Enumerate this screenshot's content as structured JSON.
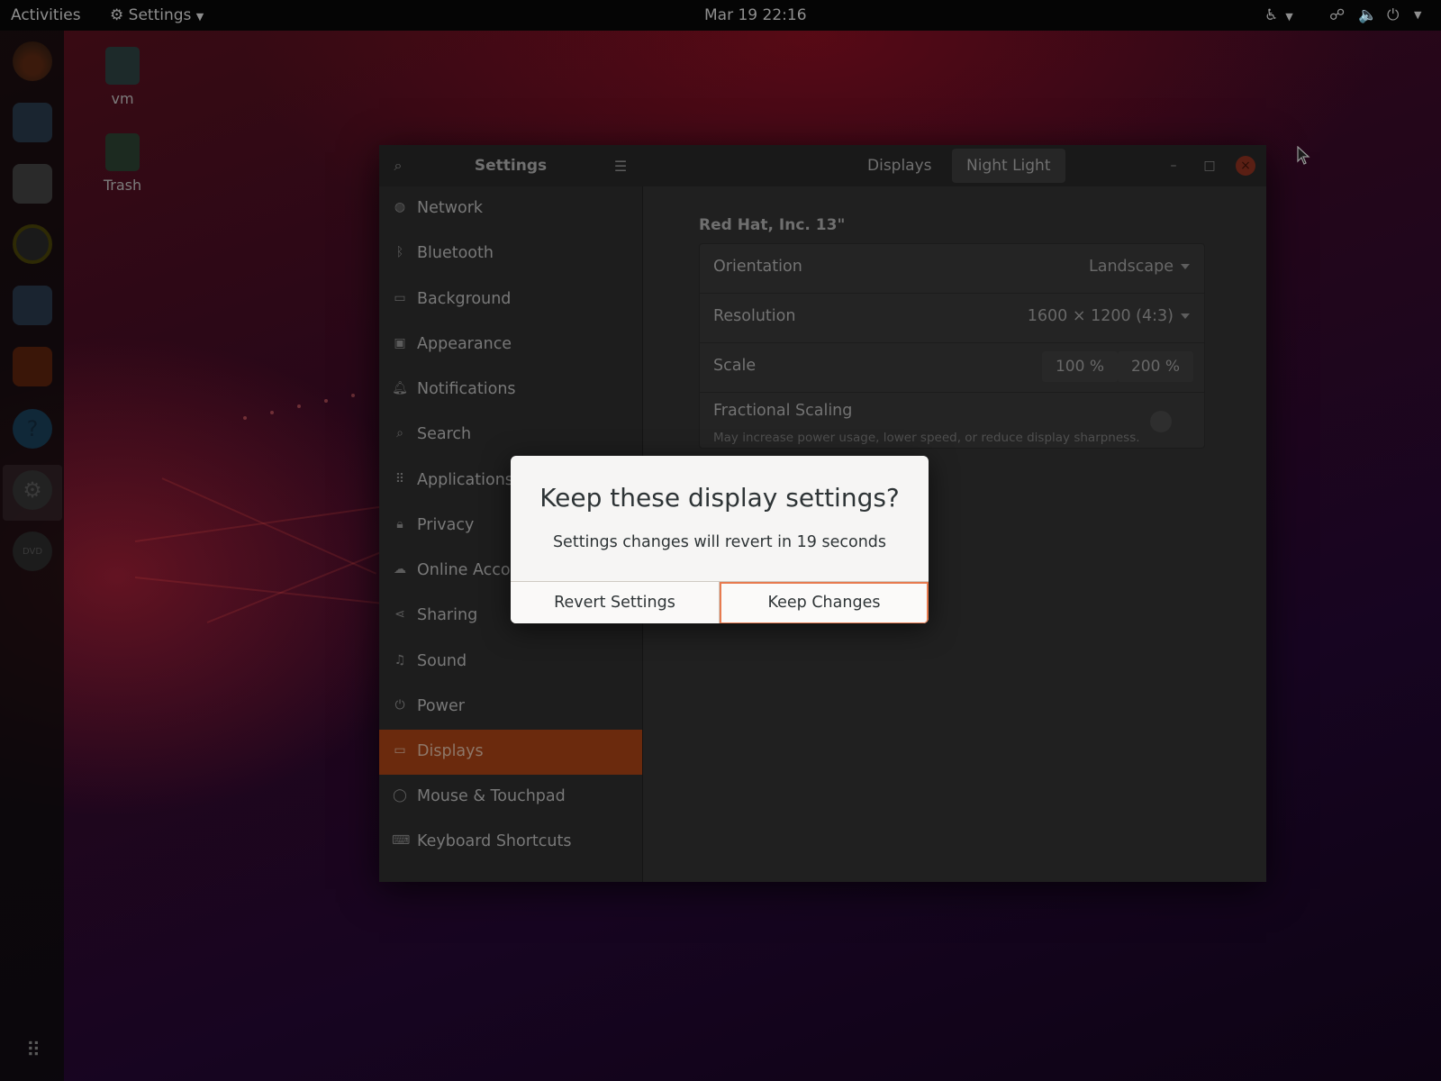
{
  "topbar": {
    "activities": "Activities",
    "app_menu": "Settings",
    "clock": "Mar 19  22:16"
  },
  "desktop": {
    "icons": [
      {
        "label": "vm"
      },
      {
        "label": "Trash"
      }
    ]
  },
  "dock": {
    "apps": [
      "firefox-icon",
      "thunderbird-icon",
      "files-icon",
      "rhythmbox-icon",
      "writer-icon",
      "software-icon",
      "help-icon",
      "settings-icon",
      "dvd-icon"
    ],
    "show_apps": "app-grid-icon"
  },
  "window": {
    "title": "Settings",
    "tabs": [
      "Displays",
      "Night Light"
    ],
    "sidebar": [
      {
        "label": "Network",
        "icon": "network-icon"
      },
      {
        "label": "Bluetooth",
        "icon": "bluetooth-icon"
      },
      {
        "label": "Background",
        "icon": "background-icon"
      },
      {
        "label": "Appearance",
        "icon": "appearance-icon"
      },
      {
        "label": "Notifications",
        "icon": "bell-icon"
      },
      {
        "label": "Search",
        "icon": "search-icon"
      },
      {
        "label": "Applications",
        "icon": "grid-icon"
      },
      {
        "label": "Privacy",
        "icon": "lock-icon"
      },
      {
        "label": "Online Accou",
        "icon": "cloud-icon"
      },
      {
        "label": "Sharing",
        "icon": "share-icon"
      },
      {
        "label": "Sound",
        "icon": "music-icon"
      },
      {
        "label": "Power",
        "icon": "power-icon"
      },
      {
        "label": "Displays",
        "icon": "display-icon",
        "active": true
      },
      {
        "label": "Mouse & Touchpad",
        "icon": "mouse-icon"
      },
      {
        "label": "Keyboard Shortcuts",
        "icon": "keyboard-icon"
      }
    ],
    "display": {
      "monitor_name": "Red Hat, Inc. 13\"",
      "orientation_label": "Orientation",
      "orientation_value": "Landscape",
      "resolution_label": "Resolution",
      "resolution_value": "1600 × 1200 (4:3)",
      "scale_label": "Scale",
      "scale_options": [
        "100 %",
        "200 %"
      ],
      "fractional_label": "Fractional Scaling",
      "fractional_sub": "May increase power usage, lower speed, or reduce display sharpness."
    }
  },
  "dialog": {
    "title": "Keep these display settings?",
    "body": "Settings changes will revert in 19 seconds",
    "revert_label": "Revert Settings",
    "keep_label": "Keep Changes"
  },
  "colors": {
    "accent": "#e95420",
    "active_sidebar": "#6b2a0d",
    "focus_border": "#e77b50"
  }
}
